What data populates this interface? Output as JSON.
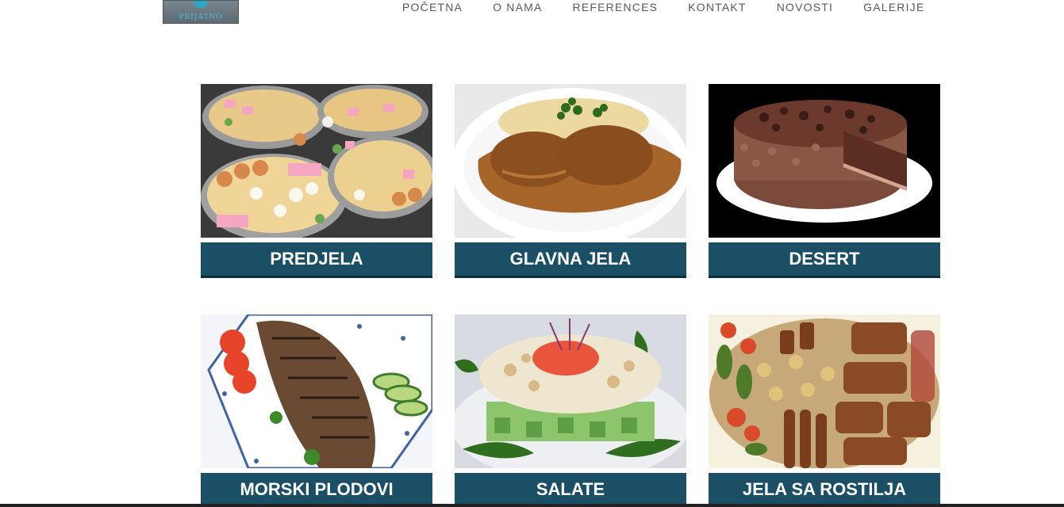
{
  "header": {
    "logo_text": "PRIJATNO",
    "nav": [
      "POČETNA",
      "O NAMA",
      "REFERENCES",
      "KONTAKT",
      "NOVOSTI",
      "GALERIJE"
    ]
  },
  "menu": {
    "categories": [
      {
        "label": "PREDJELA",
        "image": "appetizer platters"
      },
      {
        "label": "GLAVNA JELA",
        "image": "meat in sauce with mashed potatoes"
      },
      {
        "label": "DESERT",
        "image": "chocolate cake"
      },
      {
        "label": "MORSKI PLODOVI",
        "image": "grilled fish with tomato and cucumber"
      },
      {
        "label": "SALATE",
        "image": "layered salad with arugula"
      },
      {
        "label": "JELA SA ROSTILJA",
        "image": "mixed grill platter"
      }
    ]
  },
  "colors": {
    "label_bg": "#1b4f66",
    "label_border": "#0f2f3e",
    "nav_text": "#5a5a5a"
  }
}
